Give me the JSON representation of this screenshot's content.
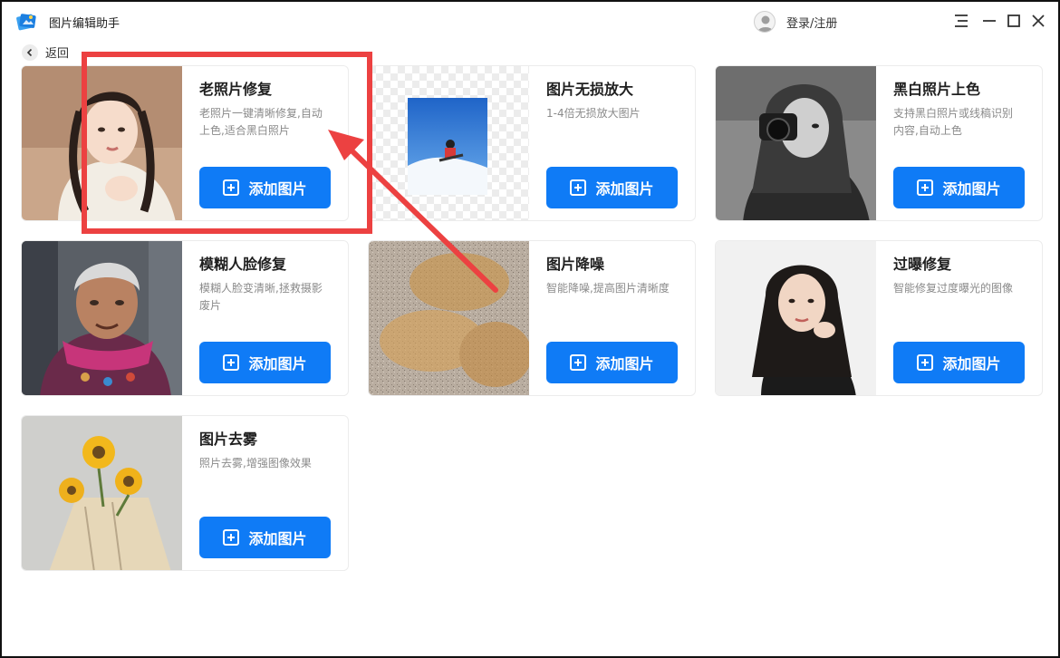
{
  "app": {
    "title": "图片编辑助手"
  },
  "header": {
    "login_label": "登录/注册"
  },
  "nav": {
    "back_label": "返回"
  },
  "cards": [
    {
      "title": "老照片修复",
      "description": "老照片一键清晰修复,自动上色,适合黑白照片",
      "button_label": "添加图片"
    },
    {
      "title": "图片无损放大",
      "description": "1-4倍无损放大图片",
      "button_label": "添加图片"
    },
    {
      "title": "黑白照片上色",
      "description": "支持黑白照片或线稿识别内容,自动上色",
      "button_label": "添加图片"
    },
    {
      "title": "模糊人脸修复",
      "description": "模糊人脸变清晰,拯救摄影废片",
      "button_label": "添加图片"
    },
    {
      "title": "图片降噪",
      "description": "智能降噪,提高图片清晰度",
      "button_label": "添加图片"
    },
    {
      "title": "过曝修复",
      "description": "智能修复过度曝光的图像",
      "button_label": "添加图片"
    },
    {
      "title": "图片去雾",
      "description": "照片去雾,增强图像效果",
      "button_label": "添加图片"
    }
  ],
  "colors": {
    "accent": "#0f7bf6",
    "annotation": "#ec4141",
    "border": "#111111"
  }
}
